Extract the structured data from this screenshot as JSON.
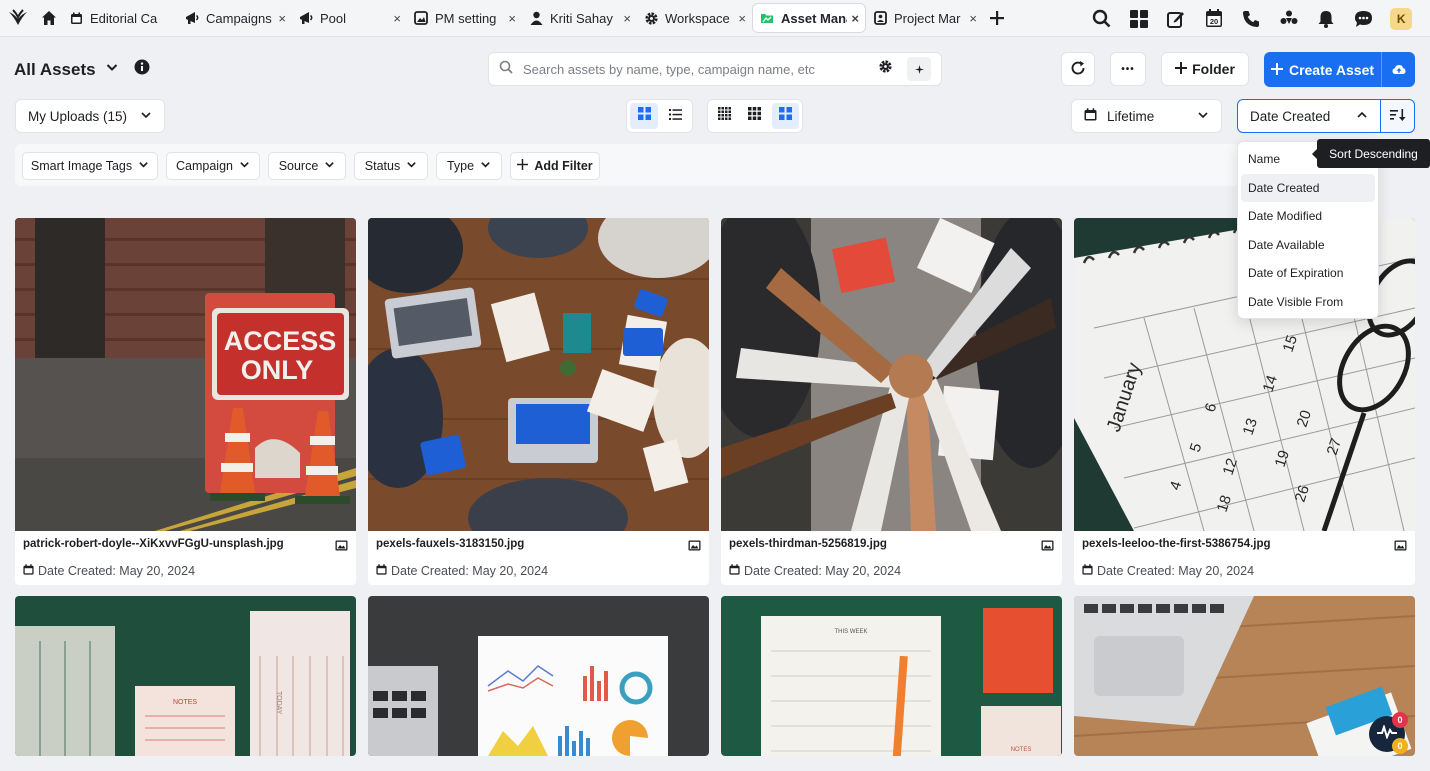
{
  "tabs": [
    {
      "label": "Editorial Ca",
      "icon": "calendar-icon"
    },
    {
      "label": "Campaigns",
      "icon": "megaphone-icon"
    },
    {
      "label": "Pool",
      "icon": "megaphone-icon"
    },
    {
      "label": "PM setting",
      "icon": "image-settings-icon"
    },
    {
      "label": "Kriti Sahay",
      "icon": "user-icon"
    },
    {
      "label": "Workspace",
      "icon": "gear-icon"
    },
    {
      "label": "Asset Mana",
      "icon": "asset-icon",
      "active": true
    },
    {
      "label": "Project Mar",
      "icon": "id-card-icon"
    }
  ],
  "tab_close": "×",
  "avatar_initial": "K",
  "calendar_day": "20",
  "page": {
    "title": "All Assets"
  },
  "search": {
    "placeholder": "Search assets by name, type, campaign name, etc"
  },
  "toolbar": {
    "folder_label": "Folder",
    "create_label": "Create Asset",
    "more_label": "•••"
  },
  "uploads_dropdown": "My Uploads (15)",
  "lifetime_dropdown": "Lifetime",
  "sort_dropdown": "Date Created",
  "filters": [
    "Smart Image Tags",
    "Campaign",
    "Source",
    "Status",
    "Type"
  ],
  "add_filter_label": "Add Filter",
  "sort_menu": [
    "Name",
    "Date Created",
    "Date Modified",
    "Date Available",
    "Date of Expiration",
    "Date Visible From"
  ],
  "sort_menu_selected": "Date Created",
  "tooltip": "Sort Descending",
  "assets": [
    {
      "name": "patrick-robert-doyle--XiKxvvFGgU-unsplash.jpg",
      "date": "Date Created: May 20, 2024",
      "sign1": "ACCESS",
      "sign2": "ONLY"
    },
    {
      "name": "pexels-fauxels-3183150.jpg",
      "date": "Date Created: May 20, 2024"
    },
    {
      "name": "pexels-thirdman-5256819.jpg",
      "date": "Date Created: May 20, 2024"
    },
    {
      "name": "pexels-leeloo-the-first-5386754.jpg",
      "date": "Date Created: May 20, 2024",
      "month": "January",
      "cal_numbers": [
        "15",
        "14",
        "6",
        "13",
        "5",
        "4",
        "12",
        "20",
        "19",
        "27",
        "18",
        "26"
      ]
    }
  ],
  "row2_labels": {
    "notes": "NOTES",
    "this_week": "THIS WEEK",
    "today": "TODAY"
  },
  "badges": {
    "red": "0",
    "yellow": "0"
  },
  "colors": {
    "accent": "#1a6ff0",
    "tooltip_bg": "#1d1f23"
  }
}
